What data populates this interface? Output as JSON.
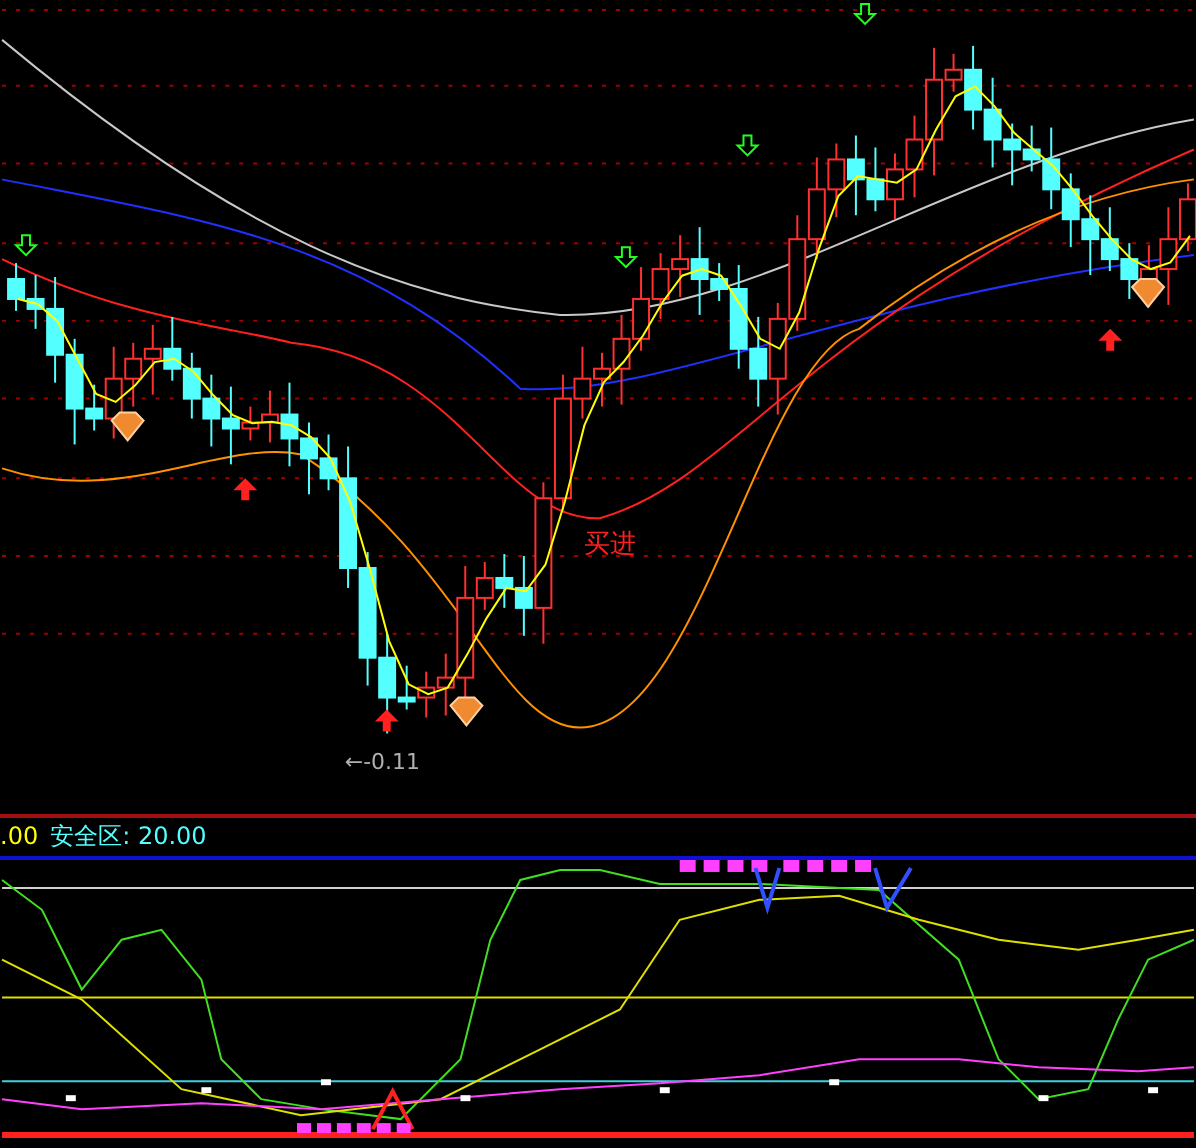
{
  "main_chart": {
    "signal_label": "买进",
    "low_label": "←-0.11"
  },
  "indicator_bar": {
    "value_fragment": ".00",
    "safe_zone_label": "安全区: 20.00"
  }
}
